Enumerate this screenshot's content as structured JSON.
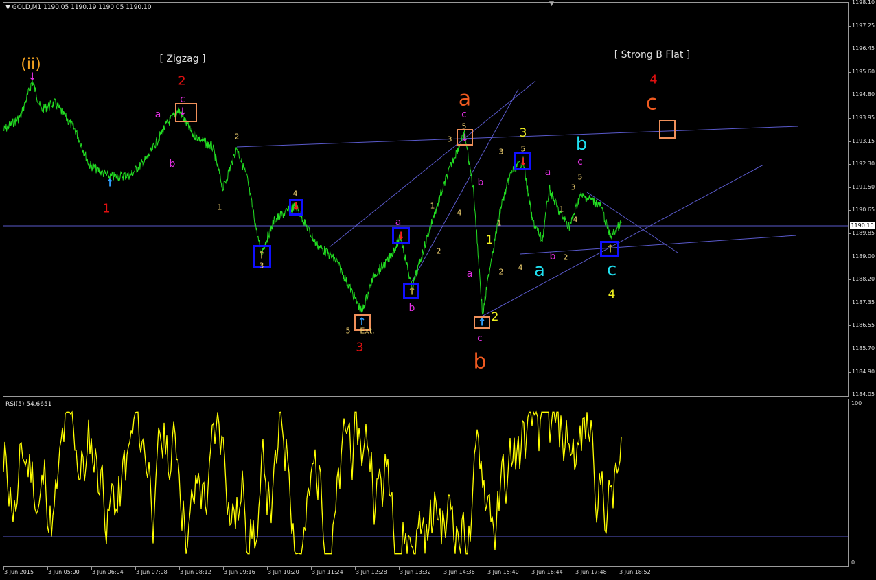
{
  "chart_header": "GOLD,M1  1190.05 1190.19 1190.05 1190.10",
  "rsi_header": "RSI(5) 54.6651",
  "price_axis": [
    "1198.10",
    "1197.25",
    "1196.45",
    "1195.60",
    "1194.80",
    "1193.95",
    "1193.15",
    "1192.30",
    "1191.50",
    "1190.65",
    "1189.85",
    "1189.00",
    "1188.20",
    "1187.35",
    "1186.55",
    "1185.70",
    "1184.90",
    "1184.05"
  ],
  "current_price": "1190.10",
  "rsi_axis": [
    "100",
    "0"
  ],
  "time_axis": [
    "3 Jun 2015",
    "3 Jun 05:00",
    "3 Jun 06:04",
    "3 Jun 07:08",
    "3 Jun 08:12",
    "3 Jun 09:16",
    "3 Jun 10:20",
    "3 Jun 11:24",
    "3 Jun 12:28",
    "3 Jun 13:32",
    "3 Jun 14:36",
    "3 Jun 15:40",
    "3 Jun 16:44",
    "3 Jun 17:48",
    "3 Jun 18:52"
  ],
  "colors": {
    "price_line": "#22dd22",
    "rsi_line": "#ffff00",
    "trend_line": "#5a5acc",
    "blue_box": "#1010ff",
    "orange_box": "#f0905a"
  },
  "annotations": {
    "bracket_zigzag": "[ Zigzag ]",
    "bracket_flat": "[ Strong B Flat ]",
    "w_ii": "(ii)",
    "w1_red": "1",
    "w2_red": "2",
    "w3_red": "3",
    "w4_red": "4",
    "big_a": "a",
    "big_b": "b",
    "big_c": "c",
    "cyan_a": "a",
    "cyan_b": "b",
    "cyan_c": "c",
    "y1": "1",
    "y2": "2",
    "y3": "3",
    "y4": "4",
    "m_a1": "a",
    "m_b1": "b",
    "m_c1": "c",
    "m_a2": "a",
    "m_b2": "b",
    "m_c2": "c",
    "m_b3": "b",
    "m_a3": "a",
    "m_c3": "c",
    "m_a4": "a",
    "m_b4": "b",
    "m_c4": "c",
    "s1": "1",
    "s2": "2",
    "s3": "3",
    "s4": "4",
    "s5": "5",
    "s6": "1",
    "s7": "2",
    "s8": "3",
    "s9": "4",
    "s10": "5",
    "s11": "3",
    "s12": "1",
    "s13": "2",
    "s14": "4",
    "s15": "3",
    "s16": "5",
    "s17": "1",
    "s18": "2",
    "s19": "4",
    "s20": "3",
    "s21": "5",
    "s22": "1",
    "s23": "4",
    "s24": "2",
    "ext": "Ext."
  },
  "icons": [
    "up-arrow-icon",
    "down-arrow-icon",
    "dropdown-triangle-icon"
  ]
}
